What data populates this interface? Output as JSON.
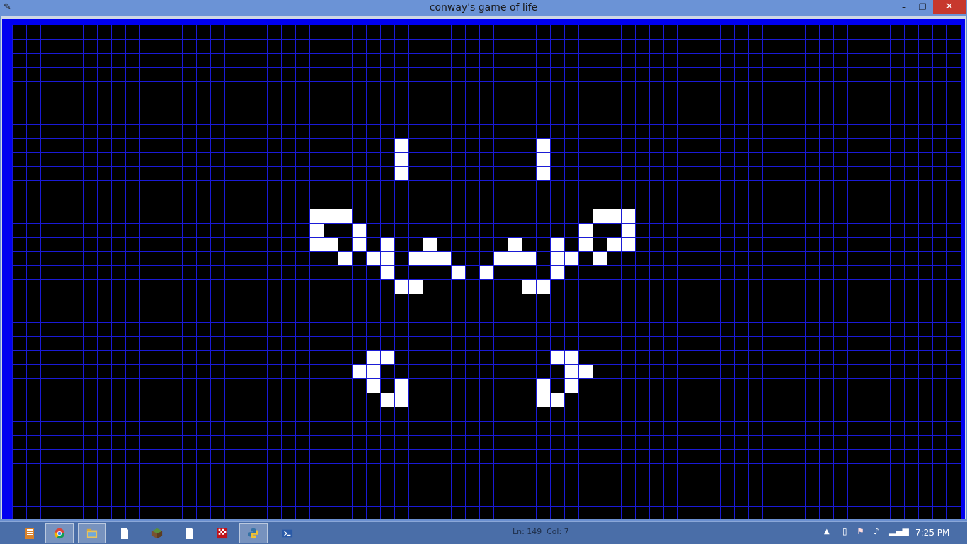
{
  "window": {
    "title": "conway's game of life",
    "minimize_label": "–",
    "maximize_label": "❐",
    "close_label": "✕"
  },
  "board": {
    "columns": 67,
    "rows": 35,
    "background_color": "#000000",
    "grid_color": "#1a1ad6",
    "border_color": "#0000f0",
    "live_cell_color": "#ffffff",
    "live_cells": [
      [
        27,
        8
      ],
      [
        37,
        8
      ],
      [
        27,
        9
      ],
      [
        37,
        9
      ],
      [
        27,
        10
      ],
      [
        37,
        10
      ],
      [
        21,
        13
      ],
      [
        22,
        13
      ],
      [
        23,
        13
      ],
      [
        41,
        13
      ],
      [
        42,
        13
      ],
      [
        43,
        13
      ],
      [
        21,
        14
      ],
      [
        24,
        14
      ],
      [
        40,
        14
      ],
      [
        43,
        14
      ],
      [
        21,
        15
      ],
      [
        22,
        15
      ],
      [
        24,
        15
      ],
      [
        26,
        15
      ],
      [
        29,
        15
      ],
      [
        35,
        15
      ],
      [
        38,
        15
      ],
      [
        40,
        15
      ],
      [
        42,
        15
      ],
      [
        43,
        15
      ],
      [
        23,
        16
      ],
      [
        25,
        16
      ],
      [
        26,
        16
      ],
      [
        28,
        16
      ],
      [
        29,
        16
      ],
      [
        30,
        16
      ],
      [
        34,
        16
      ],
      [
        35,
        16
      ],
      [
        36,
        16
      ],
      [
        38,
        16
      ],
      [
        39,
        16
      ],
      [
        41,
        16
      ],
      [
        26,
        17
      ],
      [
        31,
        17
      ],
      [
        33,
        17
      ],
      [
        38,
        17
      ],
      [
        27,
        18
      ],
      [
        28,
        18
      ],
      [
        36,
        18
      ],
      [
        37,
        18
      ],
      [
        25,
        23
      ],
      [
        26,
        23
      ],
      [
        38,
        23
      ],
      [
        39,
        23
      ],
      [
        24,
        24
      ],
      [
        25,
        24
      ],
      [
        39,
        24
      ],
      [
        40,
        24
      ],
      [
        25,
        25
      ],
      [
        27,
        25
      ],
      [
        37,
        25
      ],
      [
        39,
        25
      ],
      [
        26,
        26
      ],
      [
        27,
        26
      ],
      [
        37,
        26
      ],
      [
        38,
        26
      ]
    ]
  },
  "taskbar": {
    "items": [
      {
        "name": "notes-app-icon",
        "active": false
      },
      {
        "name": "chrome-icon",
        "active": true
      },
      {
        "name": "file-explorer-icon",
        "active": true
      },
      {
        "name": "document-icon",
        "active": false
      },
      {
        "name": "minecraft-icon",
        "active": false
      },
      {
        "name": "document-icon",
        "active": false
      },
      {
        "name": "checkered-flag-icon",
        "active": false
      },
      {
        "name": "python-icon",
        "active": true
      },
      {
        "name": "powershell-icon",
        "active": false
      }
    ],
    "status_ln": "Ln: 149",
    "status_col": "Col: 7",
    "clock": "7:25 PM"
  }
}
